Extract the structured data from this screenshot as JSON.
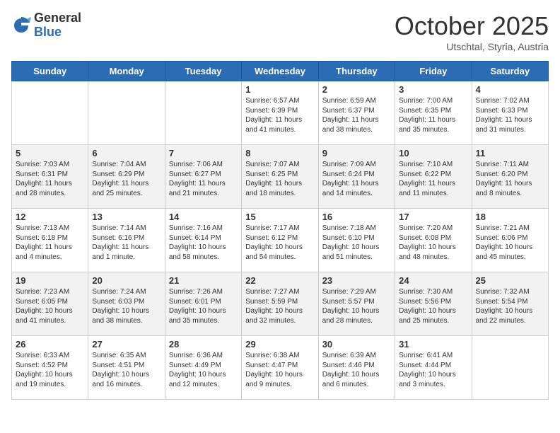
{
  "header": {
    "logo_general": "General",
    "logo_blue": "Blue",
    "month": "October 2025",
    "location": "Utschtal, Styria, Austria"
  },
  "days_of_week": [
    "Sunday",
    "Monday",
    "Tuesday",
    "Wednesday",
    "Thursday",
    "Friday",
    "Saturday"
  ],
  "weeks": [
    [
      {
        "day": "",
        "info": ""
      },
      {
        "day": "",
        "info": ""
      },
      {
        "day": "",
        "info": ""
      },
      {
        "day": "1",
        "info": "Sunrise: 6:57 AM\nSunset: 6:39 PM\nDaylight: 11 hours and 41 minutes."
      },
      {
        "day": "2",
        "info": "Sunrise: 6:59 AM\nSunset: 6:37 PM\nDaylight: 11 hours and 38 minutes."
      },
      {
        "day": "3",
        "info": "Sunrise: 7:00 AM\nSunset: 6:35 PM\nDaylight: 11 hours and 35 minutes."
      },
      {
        "day": "4",
        "info": "Sunrise: 7:02 AM\nSunset: 6:33 PM\nDaylight: 11 hours and 31 minutes."
      }
    ],
    [
      {
        "day": "5",
        "info": "Sunrise: 7:03 AM\nSunset: 6:31 PM\nDaylight: 11 hours and 28 minutes."
      },
      {
        "day": "6",
        "info": "Sunrise: 7:04 AM\nSunset: 6:29 PM\nDaylight: 11 hours and 25 minutes."
      },
      {
        "day": "7",
        "info": "Sunrise: 7:06 AM\nSunset: 6:27 PM\nDaylight: 11 hours and 21 minutes."
      },
      {
        "day": "8",
        "info": "Sunrise: 7:07 AM\nSunset: 6:25 PM\nDaylight: 11 hours and 18 minutes."
      },
      {
        "day": "9",
        "info": "Sunrise: 7:09 AM\nSunset: 6:24 PM\nDaylight: 11 hours and 14 minutes."
      },
      {
        "day": "10",
        "info": "Sunrise: 7:10 AM\nSunset: 6:22 PM\nDaylight: 11 hours and 11 minutes."
      },
      {
        "day": "11",
        "info": "Sunrise: 7:11 AM\nSunset: 6:20 PM\nDaylight: 11 hours and 8 minutes."
      }
    ],
    [
      {
        "day": "12",
        "info": "Sunrise: 7:13 AM\nSunset: 6:18 PM\nDaylight: 11 hours and 4 minutes."
      },
      {
        "day": "13",
        "info": "Sunrise: 7:14 AM\nSunset: 6:16 PM\nDaylight: 11 hours and 1 minute."
      },
      {
        "day": "14",
        "info": "Sunrise: 7:16 AM\nSunset: 6:14 PM\nDaylight: 10 hours and 58 minutes."
      },
      {
        "day": "15",
        "info": "Sunrise: 7:17 AM\nSunset: 6:12 PM\nDaylight: 10 hours and 54 minutes."
      },
      {
        "day": "16",
        "info": "Sunrise: 7:18 AM\nSunset: 6:10 PM\nDaylight: 10 hours and 51 minutes."
      },
      {
        "day": "17",
        "info": "Sunrise: 7:20 AM\nSunset: 6:08 PM\nDaylight: 10 hours and 48 minutes."
      },
      {
        "day": "18",
        "info": "Sunrise: 7:21 AM\nSunset: 6:06 PM\nDaylight: 10 hours and 45 minutes."
      }
    ],
    [
      {
        "day": "19",
        "info": "Sunrise: 7:23 AM\nSunset: 6:05 PM\nDaylight: 10 hours and 41 minutes."
      },
      {
        "day": "20",
        "info": "Sunrise: 7:24 AM\nSunset: 6:03 PM\nDaylight: 10 hours and 38 minutes."
      },
      {
        "day": "21",
        "info": "Sunrise: 7:26 AM\nSunset: 6:01 PM\nDaylight: 10 hours and 35 minutes."
      },
      {
        "day": "22",
        "info": "Sunrise: 7:27 AM\nSunset: 5:59 PM\nDaylight: 10 hours and 32 minutes."
      },
      {
        "day": "23",
        "info": "Sunrise: 7:29 AM\nSunset: 5:57 PM\nDaylight: 10 hours and 28 minutes."
      },
      {
        "day": "24",
        "info": "Sunrise: 7:30 AM\nSunset: 5:56 PM\nDaylight: 10 hours and 25 minutes."
      },
      {
        "day": "25",
        "info": "Sunrise: 7:32 AM\nSunset: 5:54 PM\nDaylight: 10 hours and 22 minutes."
      }
    ],
    [
      {
        "day": "26",
        "info": "Sunrise: 6:33 AM\nSunset: 4:52 PM\nDaylight: 10 hours and 19 minutes."
      },
      {
        "day": "27",
        "info": "Sunrise: 6:35 AM\nSunset: 4:51 PM\nDaylight: 10 hours and 16 minutes."
      },
      {
        "day": "28",
        "info": "Sunrise: 6:36 AM\nSunset: 4:49 PM\nDaylight: 10 hours and 12 minutes."
      },
      {
        "day": "29",
        "info": "Sunrise: 6:38 AM\nSunset: 4:47 PM\nDaylight: 10 hours and 9 minutes."
      },
      {
        "day": "30",
        "info": "Sunrise: 6:39 AM\nSunset: 4:46 PM\nDaylight: 10 hours and 6 minutes."
      },
      {
        "day": "31",
        "info": "Sunrise: 6:41 AM\nSunset: 4:44 PM\nDaylight: 10 hours and 3 minutes."
      },
      {
        "day": "",
        "info": ""
      }
    ]
  ]
}
